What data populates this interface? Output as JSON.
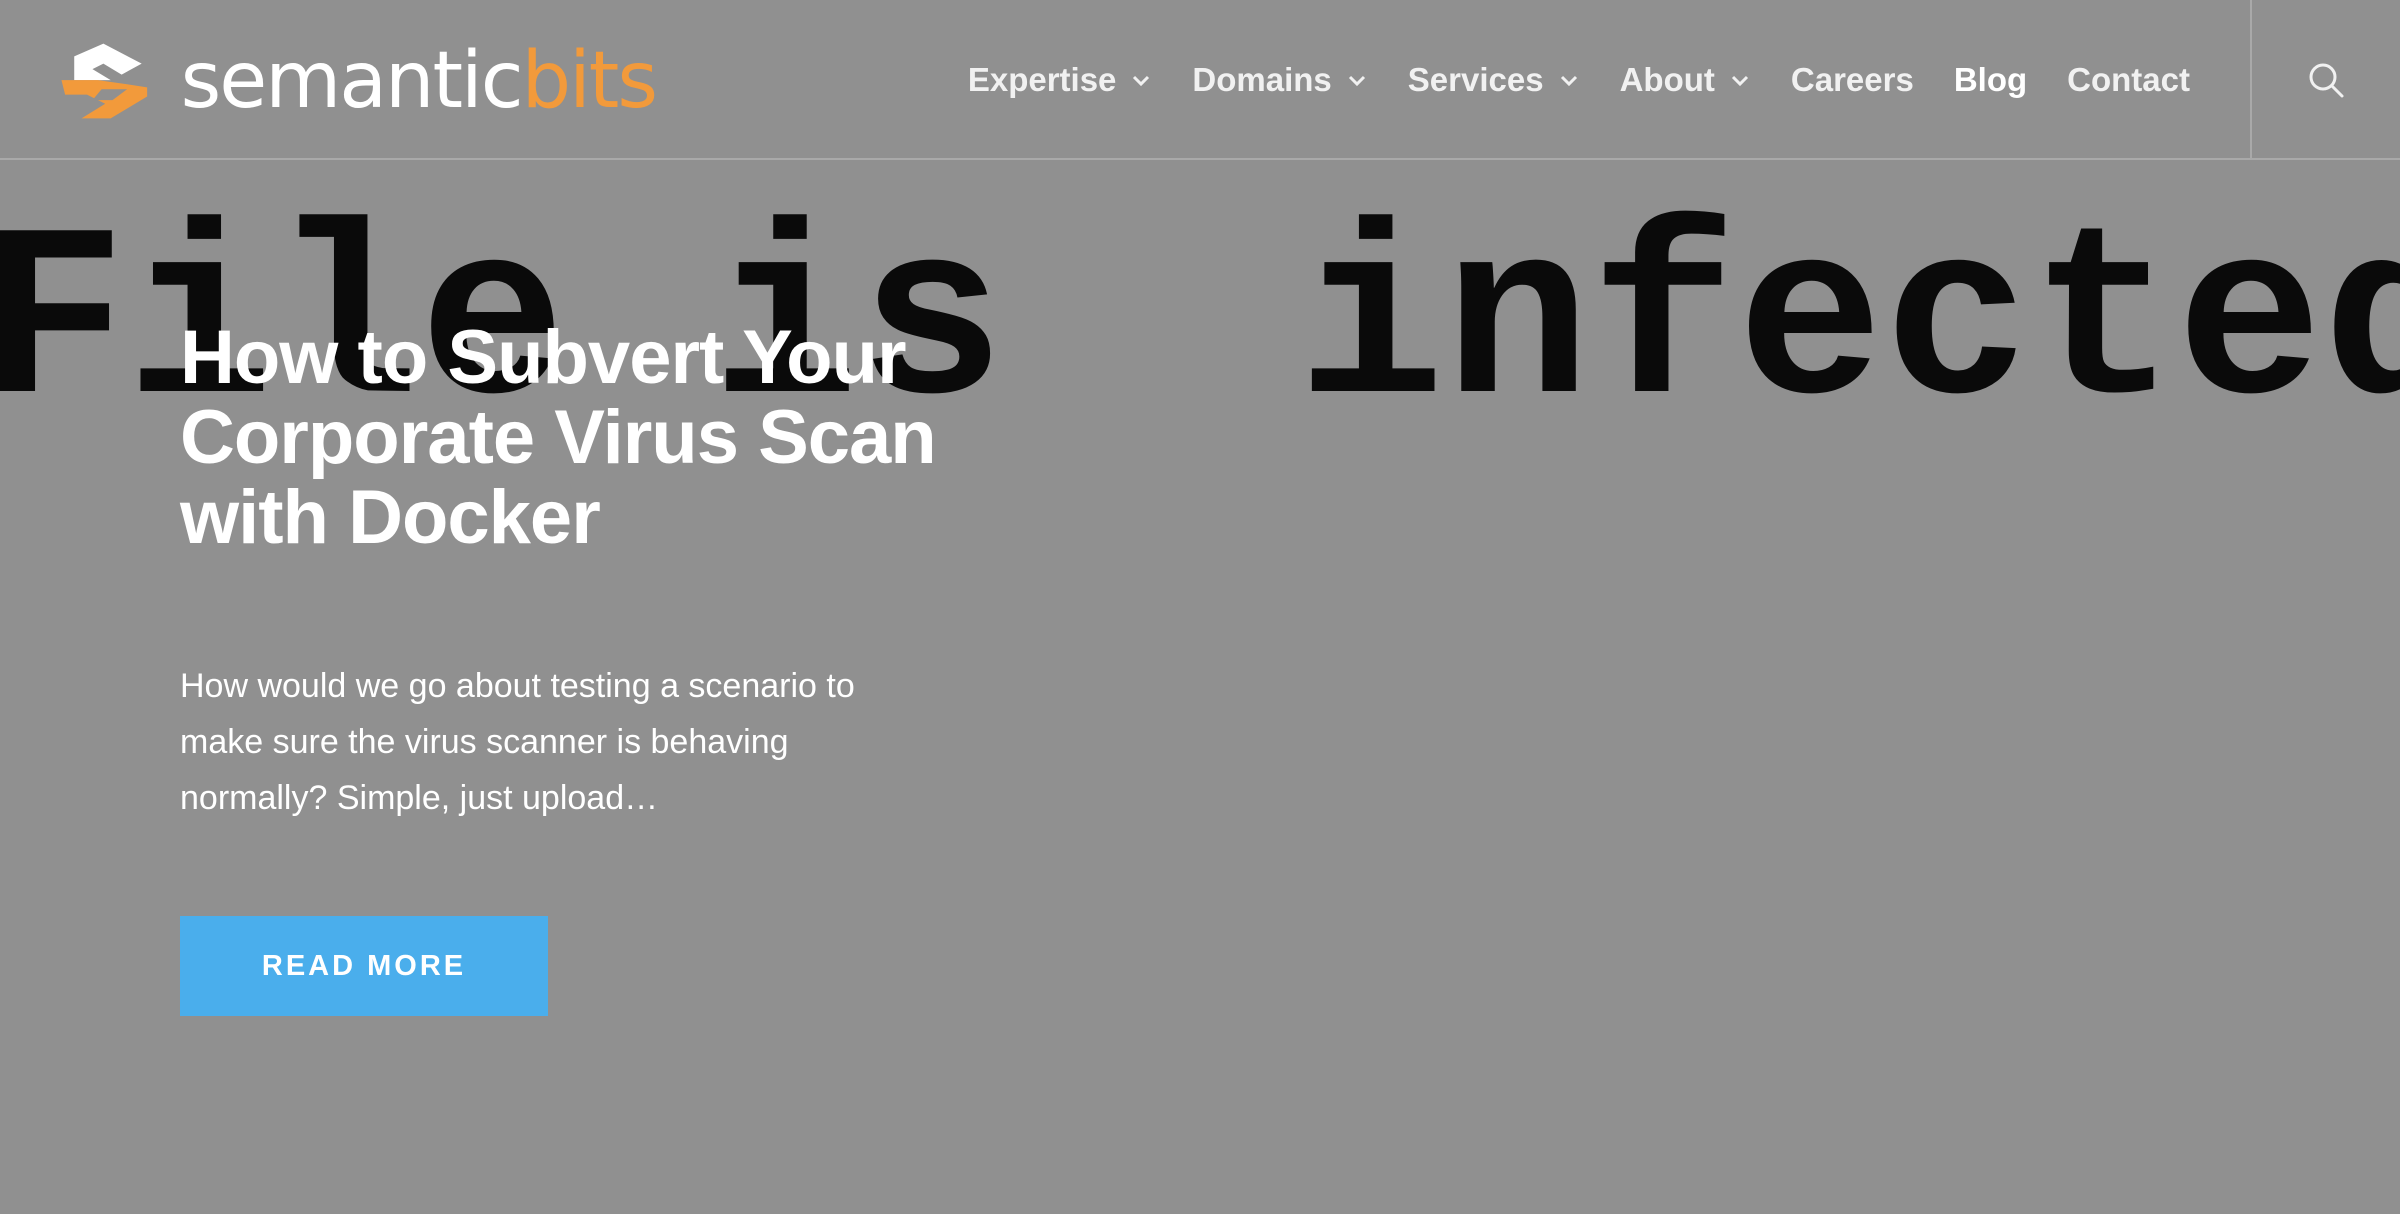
{
  "brand": {
    "logo_part1": "semantic",
    "logo_part2": "bits",
    "accent_color": "#f29a3b"
  },
  "nav": {
    "items": [
      {
        "label": "Expertise",
        "dropdown": true
      },
      {
        "label": "Domains",
        "dropdown": true
      },
      {
        "label": "Services",
        "dropdown": true
      },
      {
        "label": "About",
        "dropdown": true
      },
      {
        "label": "Careers",
        "dropdown": false
      },
      {
        "label": "Blog",
        "dropdown": false,
        "active": true
      },
      {
        "label": "Contact",
        "dropdown": false
      }
    ],
    "search_icon": "search-icon"
  },
  "hero": {
    "background_text": "File is  infected",
    "title": "How to Subvert Your Corporate Virus Scan with Docker",
    "excerpt": "How would we go about testing a scenario to make sure the virus scanner is behaving normally? Simple, just upload…",
    "cta_label": "READ MORE",
    "cta_color": "#4aaeec",
    "background_color": "#909090"
  }
}
